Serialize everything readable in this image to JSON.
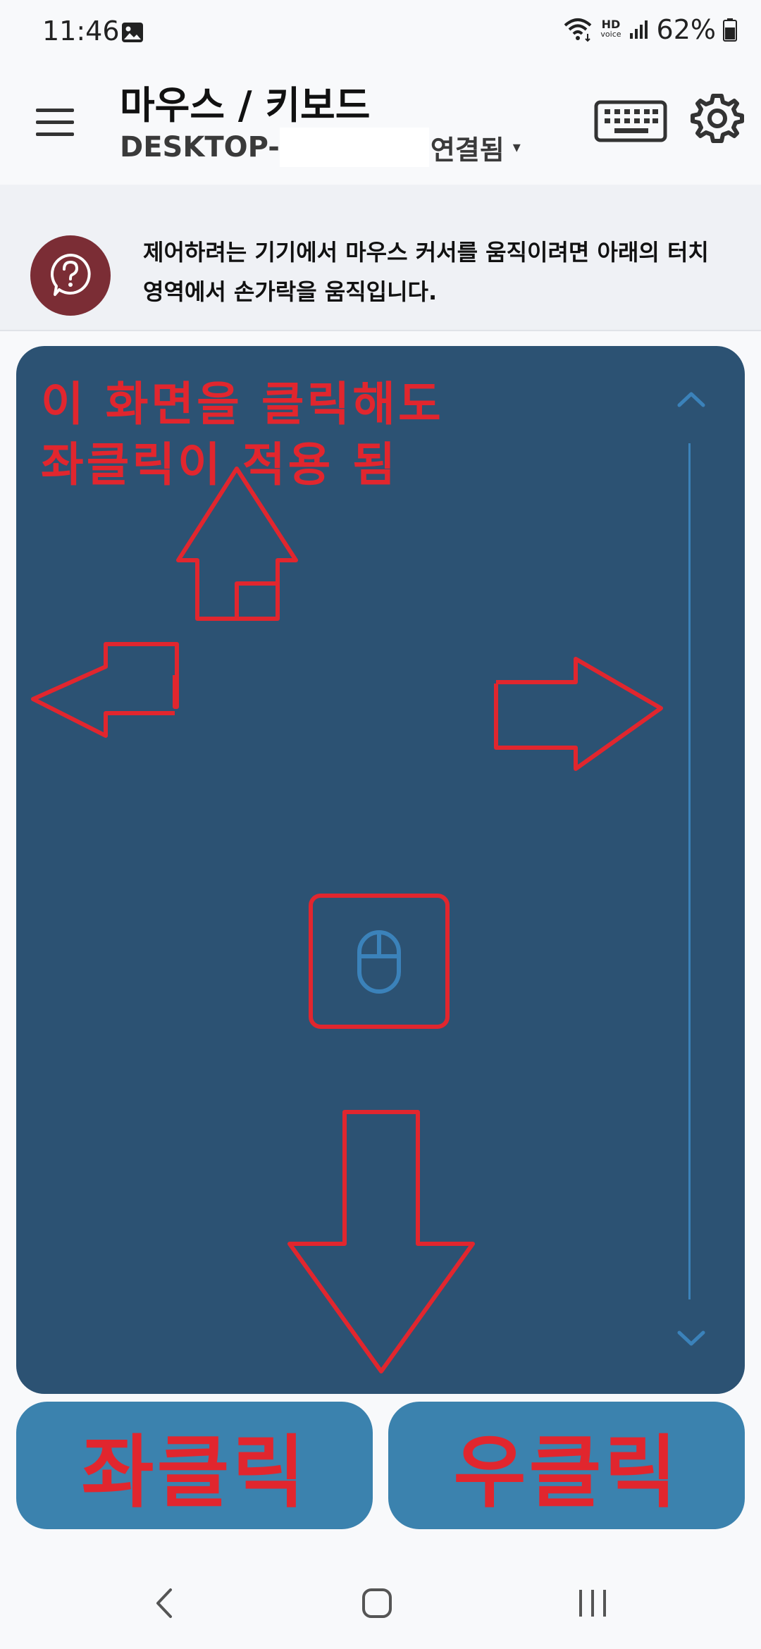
{
  "status_bar": {
    "time": "11:46",
    "network_label": "HD",
    "network_sub": "voice",
    "battery": "62%"
  },
  "header": {
    "title": "마우스 / 키보드",
    "device_name": "DESKTOP-",
    "connection_status": "연결됨",
    "caret": "▾"
  },
  "info": {
    "text": "제어하려는 기기에서 마우스 커서를 움직이려면 아래의 터치 영역에서 손가락을 움직입니다."
  },
  "touchpad": {
    "note_line1": "이 화면을 클릭해도",
    "note_line2": "좌클릭이 적용 됨"
  },
  "buttons": {
    "left_click": "좌클릭",
    "right_click": "우클릭"
  },
  "colors": {
    "touchpad_bg": "#2c5273",
    "click_button_bg": "#3b82ae",
    "annotation_red": "#e1262e",
    "help_circle": "#7b2d35"
  },
  "icons": {
    "menu": "hamburger-menu-icon",
    "keyboard": "keyboard-icon",
    "settings": "gear-icon",
    "help": "help-bubble-icon",
    "mouse": "mouse-icon"
  }
}
